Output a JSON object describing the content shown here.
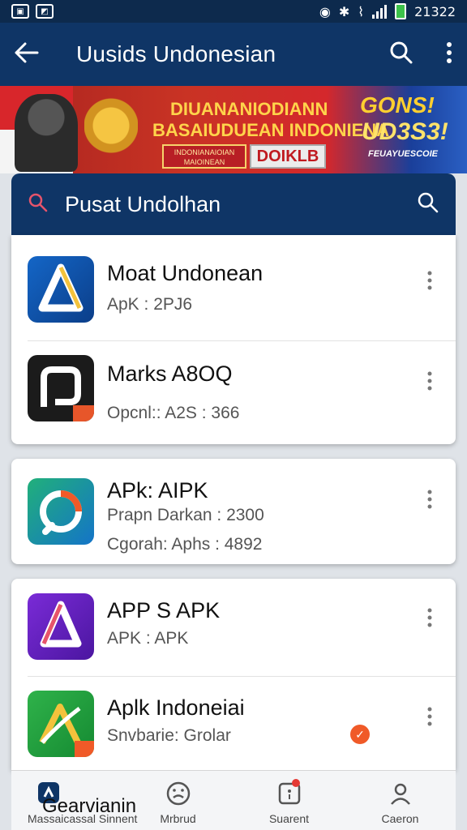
{
  "status_bar": {
    "time": "21322"
  },
  "app_bar": {
    "title": "Uusids Undonesian"
  },
  "banner": {
    "line1": "DIUANANIODIANN",
    "line2": "BASAIUDUEAN INDONIENA",
    "chip1": "INDONIANAIOIAN MAIOINEAN",
    "chip2": "DOIKLB",
    "promo1": "GONS!",
    "promo2": "UD3S3!",
    "promo3": "FEUAYUESCOIE"
  },
  "search": {
    "label": "Pusat Undolhan"
  },
  "apps": [
    {
      "name": "Moat Undonean",
      "sub1": "ApK : 2PJ6",
      "sub2": ""
    },
    {
      "name": "Marks A8OQ",
      "sub1": "Opcnl:: A2S : 366",
      "sub2": ""
    },
    {
      "name": "APk: AIPK",
      "sub1": "Prapn Darkan : 2300",
      "sub2": "Cgorah: Aphs : 4892"
    },
    {
      "name": "APP S APK",
      "sub1": "APK : APK",
      "sub2": ""
    },
    {
      "name": "Aplk Indoneiai",
      "sub1": "Snvbarie: Grolar",
      "sub2": ""
    }
  ],
  "bottom_nav": {
    "items": [
      {
        "label": "Massaicassal Sinnent",
        "big_label": "Gearvianin"
      },
      {
        "label": "Mrbrud"
      },
      {
        "label": "Suarent"
      },
      {
        "label": "Caeron"
      }
    ]
  },
  "colors": {
    "appbar": "#0f3566",
    "accent_orange": "#f05a28"
  }
}
